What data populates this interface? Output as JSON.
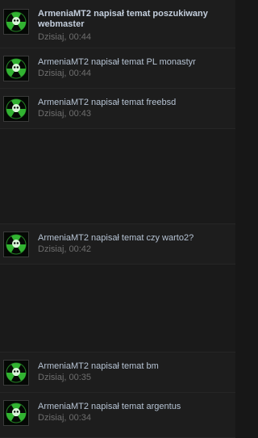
{
  "notifications": [
    {
      "title": "ArmeniaMT2 napisał temat poszukiwany webmaster",
      "time": "Dzisiaj, 00:44",
      "avatar_icon": "radiation-skull-icon"
    },
    {
      "title": "ArmeniaMT2 napisał temat PL monastyr",
      "time": "Dzisiaj, 00:44",
      "avatar_icon": "radiation-skull-icon"
    },
    {
      "title": "ArmeniaMT2 napisał temat freebsd",
      "time": "Dzisiaj, 00:43",
      "avatar_icon": "radiation-skull-icon"
    },
    {
      "title": "ArmeniaMT2 napisał temat czy warto2?",
      "time": "Dzisiaj, 00:42",
      "avatar_icon": "radiation-skull-icon"
    },
    {
      "title": "ArmeniaMT2 napisał temat bm",
      "time": "Dzisiaj, 00:35",
      "avatar_icon": "radiation-skull-icon"
    },
    {
      "title": "ArmeniaMT2 napisał temat argentus",
      "time": "Dzisiaj, 00:34",
      "avatar_icon": "radiation-skull-icon"
    }
  ],
  "colors": {
    "background": "#171717",
    "item_background": "#1d1d1d",
    "title_text": "#b6c3d3",
    "time_text": "#6e6e6e",
    "avatar_green": "#39d13a"
  }
}
